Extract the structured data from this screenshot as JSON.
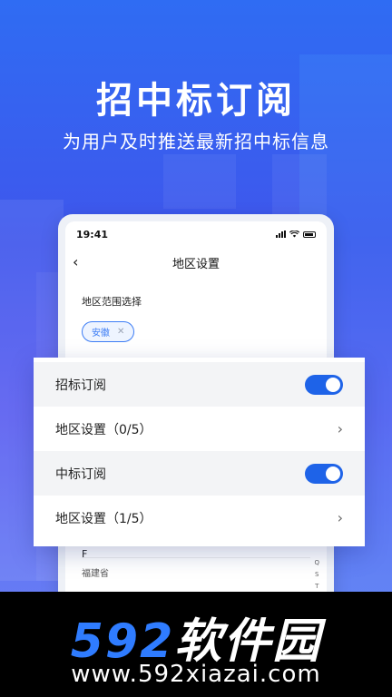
{
  "promo": {
    "headline": "招中标订阅",
    "subline": "为用户及时推送最新招中标信息"
  },
  "phone": {
    "status_time": "19:41",
    "nav_title": "地区设置",
    "region_label": "地区范围选择",
    "chip_label": "安徽",
    "list_letter": "F",
    "list_province": "福建省",
    "index_letters": [
      "Q",
      "S",
      "T"
    ]
  },
  "card": {
    "rows": [
      {
        "label": "招标订阅"
      },
      {
        "label": "地区设置（0/5）"
      },
      {
        "label": "中标订阅"
      },
      {
        "label": "地区设置（1/5）"
      }
    ]
  },
  "watermark": {
    "logo_number": "592",
    "logo_text": "软件园",
    "url": "www.592xiazai.com"
  }
}
